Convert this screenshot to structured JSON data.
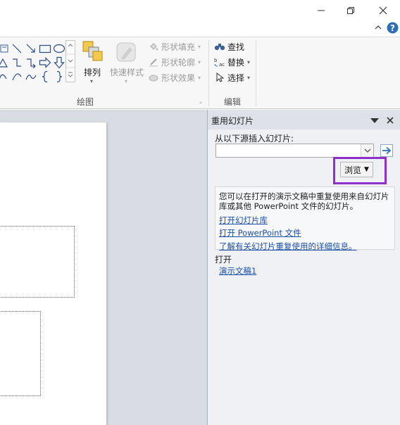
{
  "window": {
    "minimize_icon": "minimize-icon",
    "restore_icon": "restore-icon",
    "close_icon": "close-icon",
    "collapse_ribbon_icon": "chevron-up-icon",
    "help_icon": "help-icon"
  },
  "ribbon": {
    "drawing_group": {
      "label": "绘图",
      "arrange_label": "排列",
      "quick_styles_label": "快速样式",
      "shape_fill_label": "形状填充",
      "shape_outline_label": "形状轮廓",
      "shape_effects_label": "形状效果"
    },
    "editing_group": {
      "label": "编辑",
      "find_label": "查找",
      "replace_label": "替换",
      "select_label": "选择"
    }
  },
  "task_pane": {
    "title": "重用幻灯片",
    "source_label": "从以下源插入幻灯片:",
    "source_value": "",
    "browse_label": "浏览",
    "info_text": "您可以在打开的演示文稿中重复使用来自幻灯片库或其他 PowerPoint 文件的幻灯片。",
    "link_open_library": "打开幻灯片库",
    "link_open_file": "打开 PowerPoint 文件",
    "link_learn_more": "了解有关幻灯片重复使用的详细信息。",
    "open_label": "打开",
    "recent_file": "演示文稿1"
  },
  "colors": {
    "highlight": "#8e2fc9",
    "link": "#1b4fa5",
    "help_blue": "#2f6db5"
  }
}
